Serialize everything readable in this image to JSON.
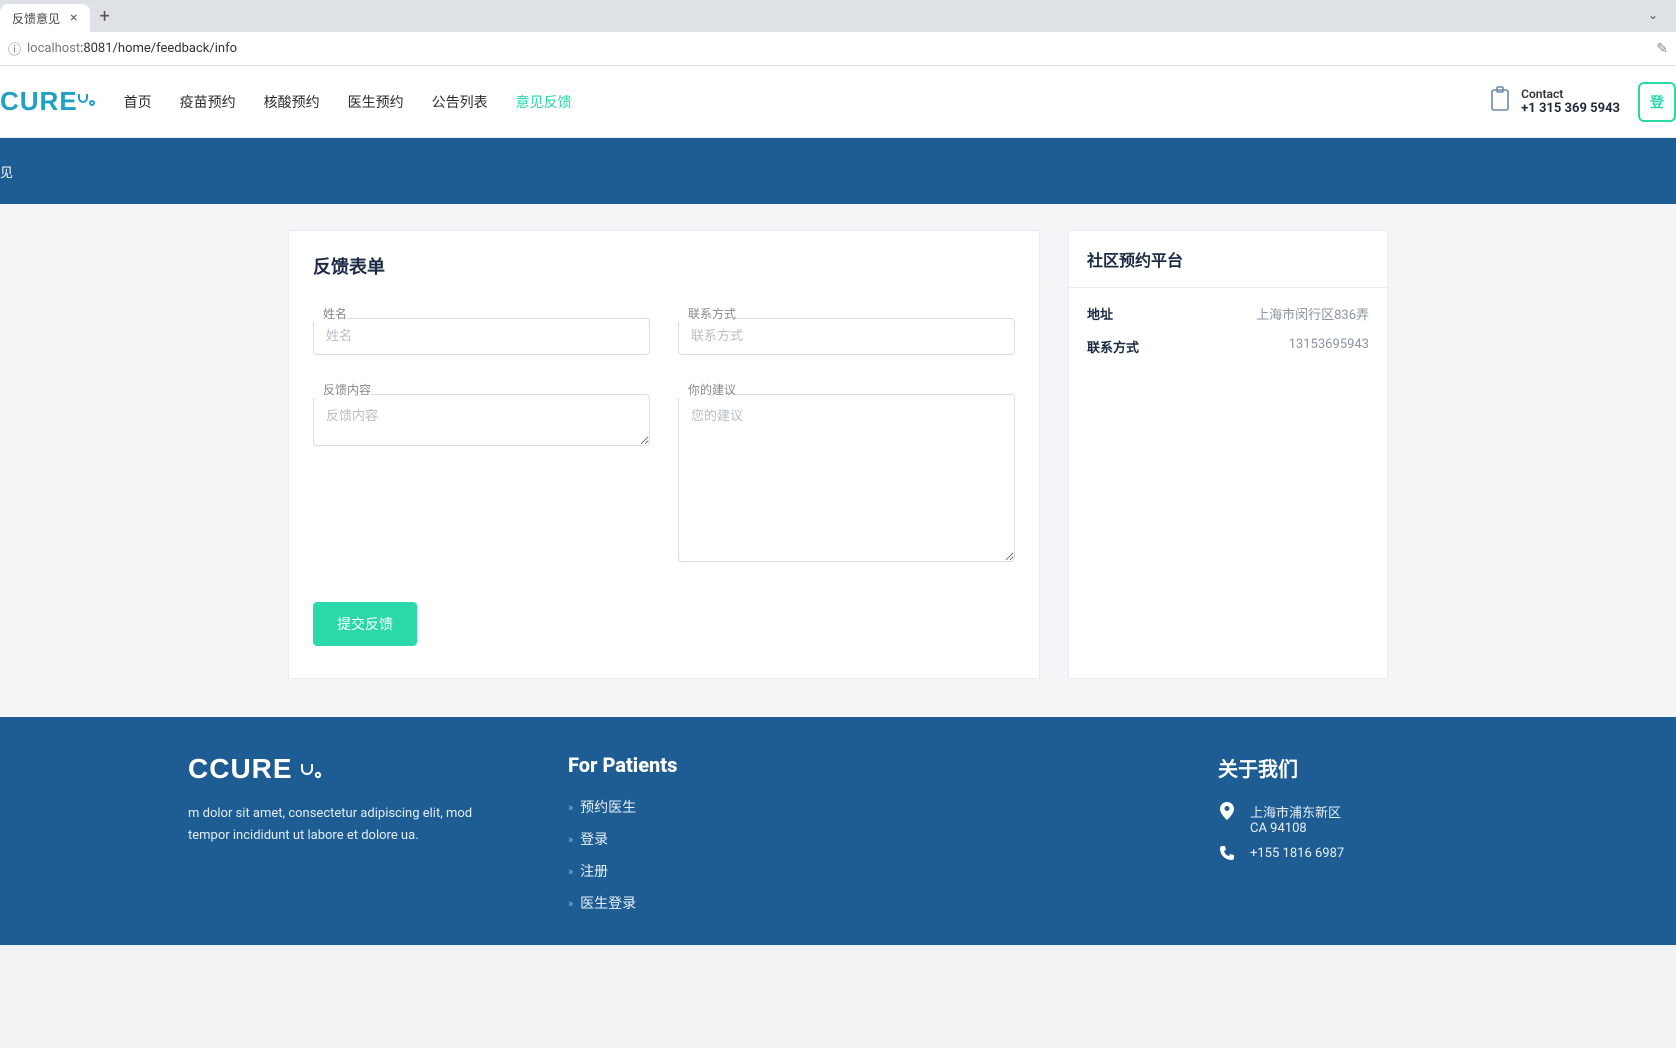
{
  "browser": {
    "tab_title": "反馈意见",
    "url_host": "localhost",
    "url_port_path": ":8081/home/feedback/info"
  },
  "logo_text": "CURE",
  "nav": {
    "items": [
      {
        "label": "首页"
      },
      {
        "label": "疫苗预约"
      },
      {
        "label": "核酸预约"
      },
      {
        "label": "医生预约"
      },
      {
        "label": "公告列表"
      },
      {
        "label": "意见反馈"
      }
    ]
  },
  "contact": {
    "label": "Contact",
    "number": "+1 315 369 5943"
  },
  "login_label": "登",
  "banner_crumb": "见",
  "form": {
    "title": "反馈表单",
    "name_label": "姓名",
    "name_placeholder": "姓名",
    "contact_label": "联系方式",
    "contact_placeholder": "联系方式",
    "content_label": "反馈内容",
    "content_placeholder": "反馈内容",
    "suggest_label": "你的建议",
    "suggest_placeholder": "您的建议",
    "submit_label": "提交反馈"
  },
  "side": {
    "title": "社区预约平台",
    "rows": [
      {
        "k": "地址",
        "v": "上海市闵行区836弄"
      },
      {
        "k": "联系方式",
        "v": "13153695943"
      }
    ]
  },
  "footer": {
    "logo": "CCURE",
    "desc": "m dolor sit amet, consectetur adipiscing elit, mod tempor incididunt ut labore et dolore ua.",
    "patients_title": "For Patients",
    "patients_links": [
      "预约医生",
      "登录",
      "注册",
      "医生登录"
    ],
    "about_title": "关于我们",
    "address_line1": "上海市浦东新区",
    "address_line2": "CA 94108",
    "phone": "+155 1816 6987"
  }
}
